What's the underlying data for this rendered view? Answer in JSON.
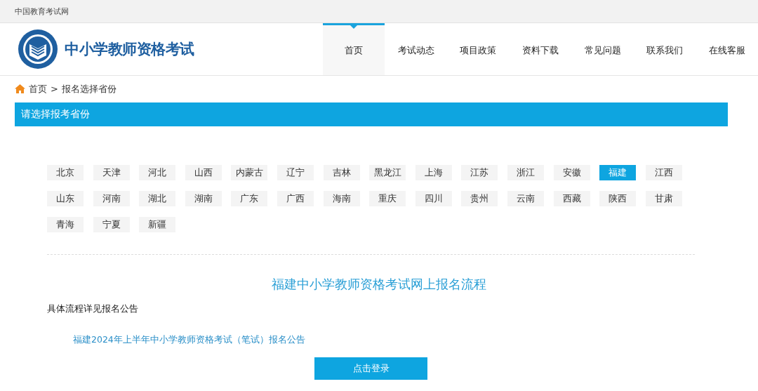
{
  "top_bar": {
    "site_name": "中国教育考试网"
  },
  "header": {
    "logo_text": "中小学教师资格考试"
  },
  "nav": [
    {
      "label": "首页",
      "selected": true
    },
    {
      "label": "考试动态",
      "selected": false
    },
    {
      "label": "项目政策",
      "selected": false
    },
    {
      "label": "资料下载",
      "selected": false
    },
    {
      "label": "常见问题",
      "selected": false
    },
    {
      "label": "联系我们",
      "selected": false
    },
    {
      "label": "在线客服",
      "selected": false
    }
  ],
  "breadcrumb": {
    "home": "首页",
    "separator": ">",
    "current": "报名选择省份"
  },
  "section_title": "请选择报考省份",
  "provinces": [
    {
      "label": "北京",
      "selected": false
    },
    {
      "label": "天津",
      "selected": false
    },
    {
      "label": "河北",
      "selected": false
    },
    {
      "label": "山西",
      "selected": false
    },
    {
      "label": "内蒙古",
      "selected": false
    },
    {
      "label": "辽宁",
      "selected": false
    },
    {
      "label": "吉林",
      "selected": false
    },
    {
      "label": "黑龙江",
      "selected": false
    },
    {
      "label": "上海",
      "selected": false
    },
    {
      "label": "江苏",
      "selected": false
    },
    {
      "label": "浙江",
      "selected": false
    },
    {
      "label": "安徽",
      "selected": false
    },
    {
      "label": "福建",
      "selected": true
    },
    {
      "label": "江西",
      "selected": false
    },
    {
      "label": "山东",
      "selected": false
    },
    {
      "label": "河南",
      "selected": false
    },
    {
      "label": "湖北",
      "selected": false
    },
    {
      "label": "湖南",
      "selected": false
    },
    {
      "label": "广东",
      "selected": false
    },
    {
      "label": "广西",
      "selected": false
    },
    {
      "label": "海南",
      "selected": false
    },
    {
      "label": "重庆",
      "selected": false
    },
    {
      "label": "四川",
      "selected": false
    },
    {
      "label": "贵州",
      "selected": false
    },
    {
      "label": "云南",
      "selected": false
    },
    {
      "label": "西藏",
      "selected": false
    },
    {
      "label": "陕西",
      "selected": false
    },
    {
      "label": "甘肃",
      "selected": false
    },
    {
      "label": "青海",
      "selected": false
    },
    {
      "label": "宁夏",
      "selected": false
    },
    {
      "label": "新疆",
      "selected": false
    }
  ],
  "process": {
    "title": "福建中小学教师资格考试网上报名流程",
    "note": "具体流程详见报名公告",
    "link": "福建2024年上半年中小学教师资格考试（笔试）报名公告",
    "button": "点击登录"
  }
}
